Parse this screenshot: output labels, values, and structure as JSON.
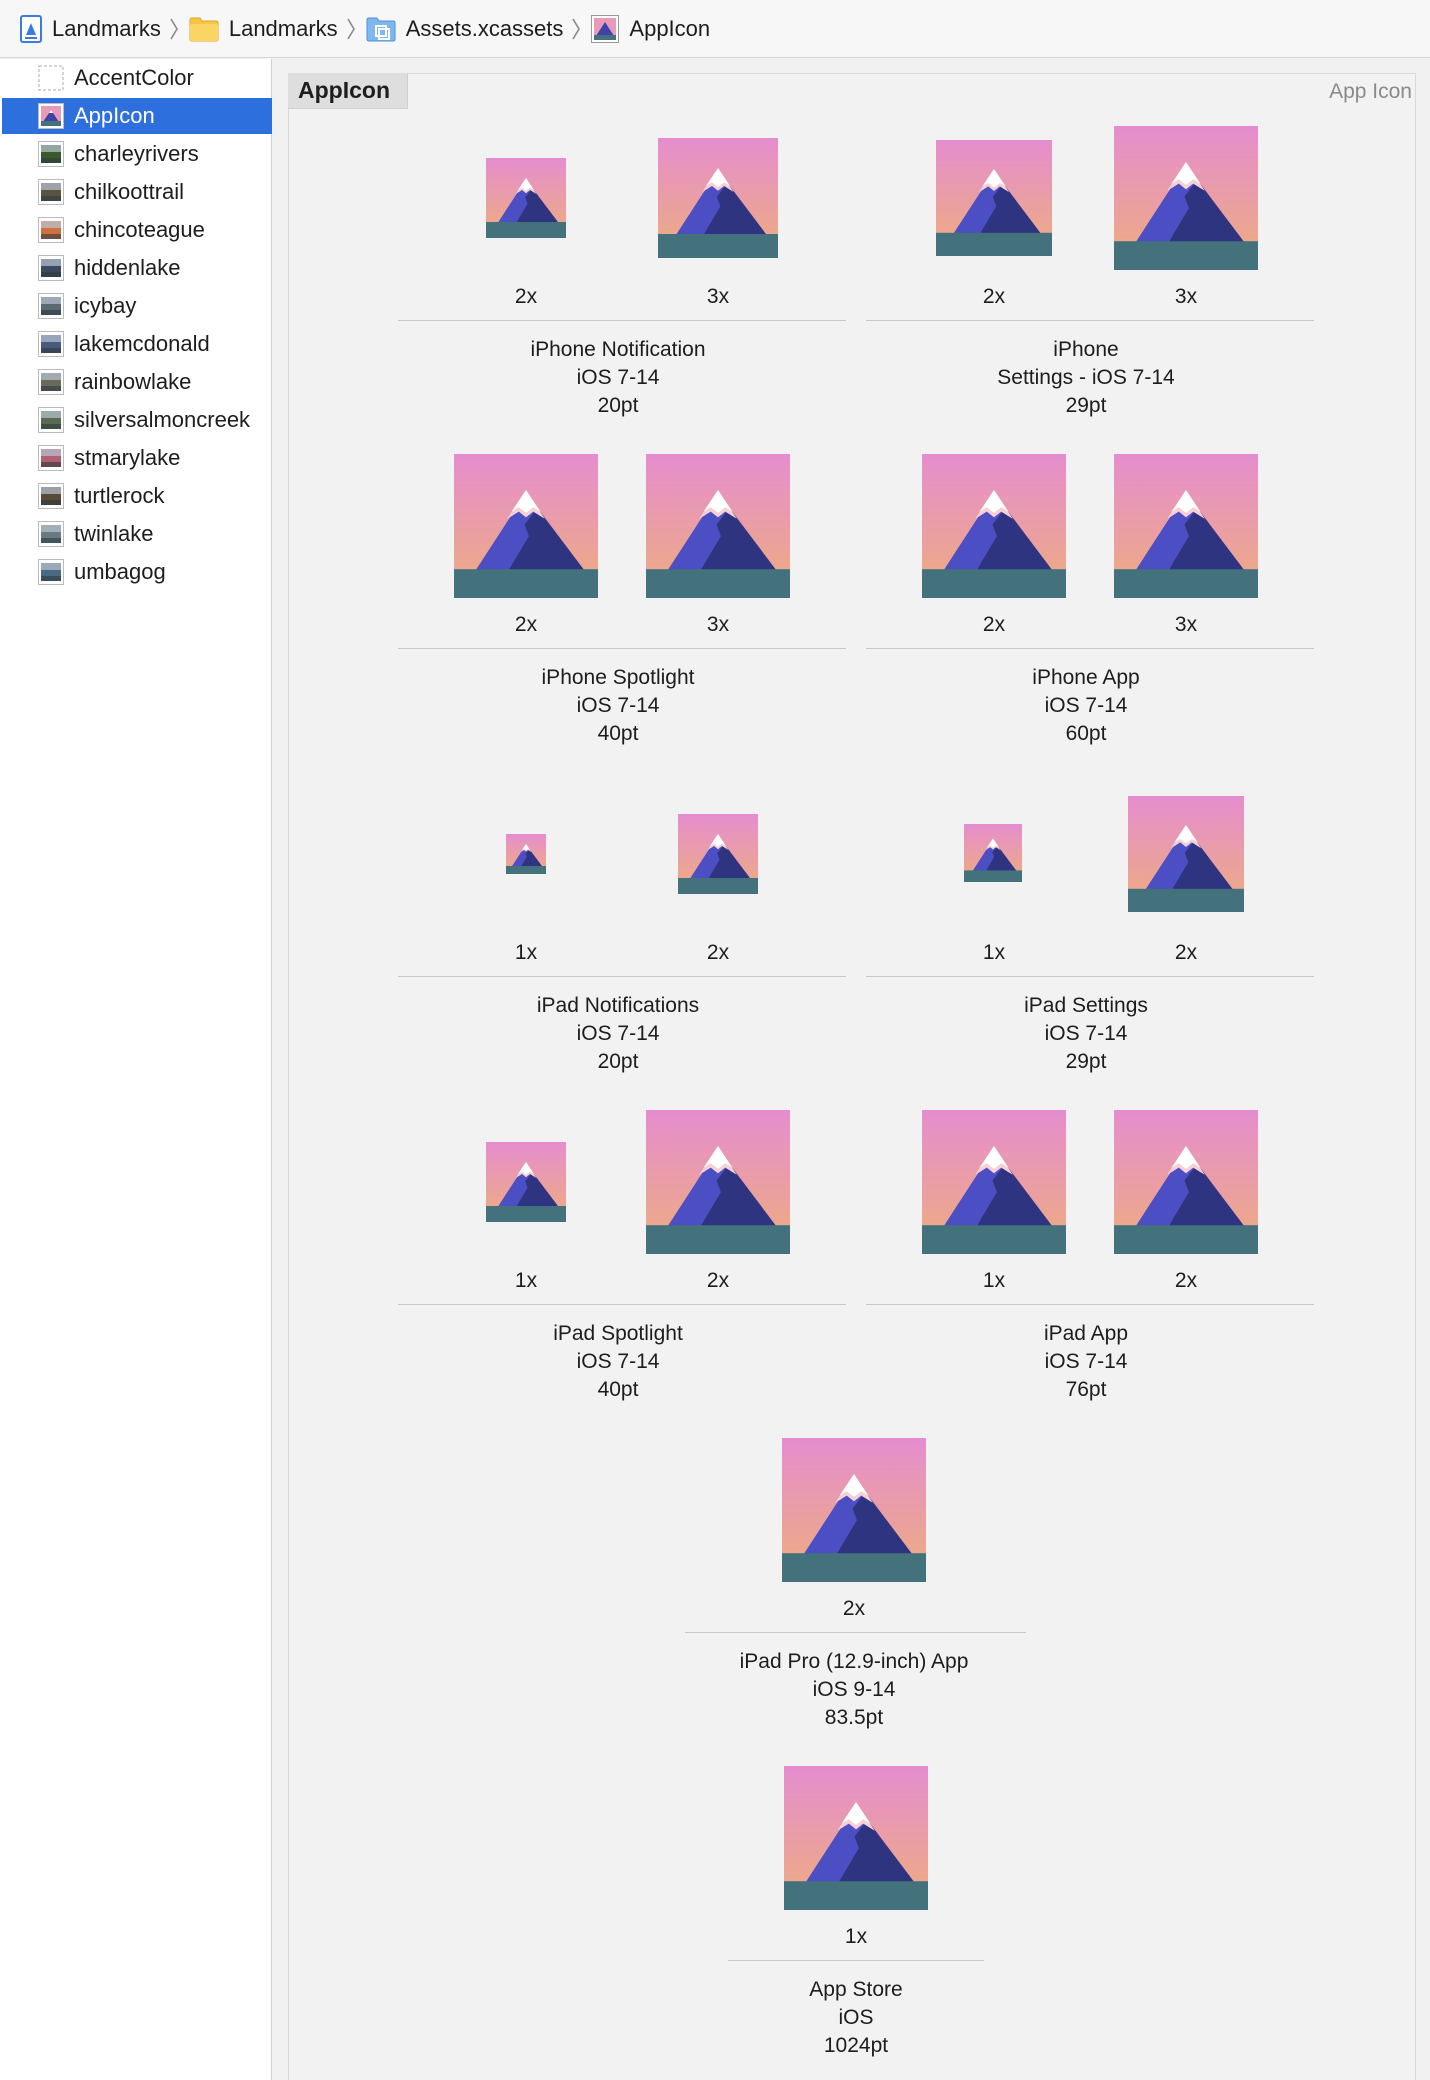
{
  "breadcrumb": {
    "items": [
      {
        "label": "Landmarks",
        "icon": "swift-project-icon"
      },
      {
        "label": "Landmarks",
        "icon": "folder-icon"
      },
      {
        "label": "Assets.xcassets",
        "icon": "asset-catalog-icon"
      },
      {
        "label": "AppIcon",
        "icon": "appicon-thumbnail-icon"
      }
    ]
  },
  "sidebar": {
    "items": [
      {
        "label": "AccentColor",
        "thumb": "color-set-icon"
      },
      {
        "label": "AppIcon",
        "thumb": "appicon-thumbnail-icon",
        "selected": true
      },
      {
        "label": "charleyrivers",
        "thumb": "image-thumbnail-icon"
      },
      {
        "label": "chilkoottrail",
        "thumb": "image-thumbnail-icon"
      },
      {
        "label": "chincoteague",
        "thumb": "image-thumbnail-icon"
      },
      {
        "label": "hiddenlake",
        "thumb": "image-thumbnail-icon"
      },
      {
        "label": "icybay",
        "thumb": "image-thumbnail-icon"
      },
      {
        "label": "lakemcdonald",
        "thumb": "image-thumbnail-icon"
      },
      {
        "label": "rainbowlake",
        "thumb": "image-thumbnail-icon"
      },
      {
        "label": "silversalmoncreek",
        "thumb": "image-thumbnail-icon"
      },
      {
        "label": "stmarylake",
        "thumb": "image-thumbnail-icon"
      },
      {
        "label": "turtlerock",
        "thumb": "image-thumbnail-icon"
      },
      {
        "label": "twinlake",
        "thumb": "image-thumbnail-icon"
      },
      {
        "label": "umbagog",
        "thumb": "image-thumbnail-icon"
      }
    ]
  },
  "editor": {
    "asset_name": "AppIcon",
    "asset_type": "App Icon"
  },
  "groups": [
    {
      "lines": [
        "iPhone Notification",
        "iOS 7-14",
        "20pt"
      ],
      "scales": [
        "2x",
        "3x"
      ]
    },
    {
      "lines": [
        "iPhone",
        "Settings - iOS 7-14",
        "29pt"
      ],
      "scales": [
        "2x",
        "3x"
      ]
    },
    {
      "lines": [
        "iPhone Spotlight",
        "iOS 7-14",
        "40pt"
      ],
      "scales": [
        "2x",
        "3x"
      ]
    },
    {
      "lines": [
        "iPhone App",
        "iOS 7-14",
        "60pt"
      ],
      "scales": [
        "2x",
        "3x"
      ]
    },
    {
      "lines": [
        "iPad Notifications",
        "iOS 7-14",
        "20pt"
      ],
      "scales": [
        "1x",
        "2x"
      ]
    },
    {
      "lines": [
        "iPad Settings",
        "iOS 7-14",
        "29pt"
      ],
      "scales": [
        "1x",
        "2x"
      ]
    },
    {
      "lines": [
        "iPad Spotlight",
        "iOS 7-14",
        "40pt"
      ],
      "scales": [
        "1x",
        "2x"
      ]
    },
    {
      "lines": [
        "iPad App",
        "iOS 7-14",
        "76pt"
      ],
      "scales": [
        "1x",
        "2x"
      ]
    },
    {
      "lines": [
        "iPad Pro (12.9-inch) App",
        "iOS 9-14",
        "83.5pt"
      ],
      "scales": [
        "2x"
      ]
    },
    {
      "lines": [
        "App Store",
        "iOS",
        "1024pt"
      ],
      "scales": [
        "1x"
      ]
    }
  ],
  "colors": {
    "selection": "#2d6fdc",
    "icon_sky_top": "#e58dcf",
    "icon_sky_bottom": "#eeae7c",
    "icon_mountain_dark": "#2e3480",
    "icon_mountain_light": "#4c4fc4",
    "icon_ground": "#43717c"
  }
}
